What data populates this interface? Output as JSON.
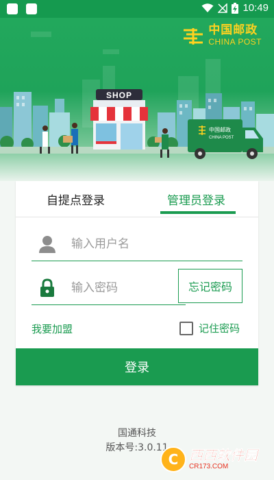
{
  "status_bar": {
    "time": "10:49"
  },
  "brand": {
    "name_cn": "中国邮政",
    "name_en": "CHINA POST",
    "color": "#ffd21f"
  },
  "hero": {
    "shop_sign": "SHOP",
    "truck_name_cn": "中国邮政",
    "truck_name_en": "CHINA POST"
  },
  "login_tabs": [
    {
      "label": "自提点登录",
      "active": false
    },
    {
      "label": "管理员登录",
      "active": true
    }
  ],
  "form": {
    "username": {
      "placeholder": "输入用户名",
      "value": "",
      "icon": "user-icon"
    },
    "password": {
      "placeholder": "输入密码",
      "value": "",
      "icon": "lock-icon"
    },
    "forgot_label": "忘记密码",
    "join_label": "我要加盟",
    "remember_label": "记住密码",
    "remember_checked": false,
    "submit_label": "登录"
  },
  "footer": {
    "company": "国通科技",
    "version": "版本号:3.0.11"
  },
  "watermark": {
    "name_cn": "西西软件园",
    "domain": "CR173.COM"
  },
  "colors": {
    "accent": "#1a9b50",
    "status_bar": "#159a4f"
  }
}
